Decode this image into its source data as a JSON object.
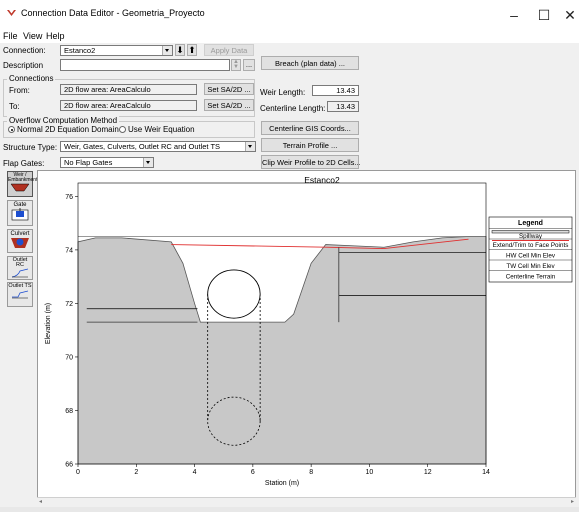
{
  "window": {
    "title": "Connection Data Editor - Geometria_Proyecto",
    "minimize": "–",
    "maximize": "☐",
    "close": "✕"
  },
  "menu": [
    "File",
    "View",
    "Help"
  ],
  "form": {
    "connection_label": "Connection:",
    "connection_value": "Estanco2",
    "apply_label": "Apply Data",
    "description_label": "Description",
    "description_value": "",
    "desc_btn": "...",
    "breach_btn": "Breach (plan data) ...",
    "connections_group": "Connections",
    "from_label": "From:",
    "from_value": "2D flow area: AreaCalculo",
    "to_label": "To:",
    "to_value": "2D flow area: AreaCalculo",
    "set_btn": "Set SA/2D ...",
    "weir_length_label": "Weir Length:",
    "weir_length_value": "13.43",
    "centerline_length_label": "Centerline Length:",
    "centerline_length_value": "13.43",
    "overflow_group": "Overflow Computation Method",
    "radio_normal": "Normal 2D Equation Domain",
    "radio_weir": "Use Weir Equation",
    "centerline_gis_btn": "Centerline GIS Coords...",
    "structure_type_label": "Structure Type:",
    "structure_type_value": "Weir, Gates, Culverts, Outlet RC and Outlet TS",
    "terrain_btn": "Terrain Profile ...",
    "flap_gates_label": "Flap Gates:",
    "flap_gates_value": "No Flap Gates",
    "clip_btn": "Clip Weir Profile to 2D Cells..."
  },
  "sidebar": [
    {
      "label": "Weir / Embankment",
      "icon": "weir-embankment-icon"
    },
    {
      "label": "Gate",
      "icon": "gate-icon"
    },
    {
      "label": "Culvert",
      "icon": "culvert-icon"
    },
    {
      "label": "Outlet RC",
      "icon": "outlet-rc-icon"
    },
    {
      "label": "Outlet TS",
      "icon": "outlet-ts-icon"
    }
  ],
  "chart_data": {
    "type": "line",
    "title": "Estanco2",
    "xlabel": "Station (m)",
    "ylabel": "Elevation (m)",
    "xlim": [
      0,
      14
    ],
    "ylim": [
      66,
      76.5
    ],
    "xticks": [
      0,
      2,
      4,
      6,
      8,
      10,
      12,
      14
    ],
    "yticks": [
      66,
      68,
      70,
      72,
      74,
      76
    ],
    "legend": {
      "title": "Legend",
      "placement": "right",
      "items": [
        {
          "label": "Spillway",
          "color": "#000000",
          "style": "double"
        },
        {
          "label": "Extend/Trim to Face Points",
          "color": "#e03030",
          "style": "solid"
        },
        {
          "label": "HW Cell Min Elev",
          "color": "#000000",
          "style": "none"
        },
        {
          "label": "TW Cell Min Elev",
          "color": "#000000",
          "style": "none"
        },
        {
          "label": "Centerline Terrain",
          "color": "#000000",
          "style": "none"
        }
      ]
    },
    "terrain": {
      "x": [
        0,
        0.6,
        1.5,
        3.2,
        3.6,
        4.0,
        4.2,
        4.35,
        7.1,
        7.4,
        8.0,
        8.5,
        9.5,
        10.5,
        11.5,
        12.5,
        13.4,
        14.0
      ],
      "y": [
        74.3,
        74.45,
        74.45,
        74.3,
        73.5,
        72.0,
        71.3,
        71.3,
        71.3,
        71.6,
        73.5,
        74.2,
        74.15,
        74.1,
        74.3,
        74.45,
        74.5,
        74.5
      ]
    },
    "extend_trim": {
      "x": [
        3.2,
        8.5,
        10.5,
        13.4
      ],
      "y": [
        74.2,
        74.1,
        74.05,
        74.4
      ]
    },
    "weir_top": {
      "x": [
        0,
        14
      ],
      "y": [
        74.5,
        74.5
      ]
    },
    "hw_cell_min_elev": {
      "x": [
        0.3,
        4.1
      ],
      "y": [
        71.8,
        71.8
      ]
    },
    "tw_cell_min_elev": {
      "x": [
        8.95,
        14.0
      ],
      "y": [
        72.3,
        72.3
      ]
    },
    "culvert": {
      "center_x": 5.35,
      "top_diameter": 1.8,
      "inlet_center_y": 72.35,
      "outlet_center_y": 67.6,
      "outlet_diameter": 1.8
    },
    "interior_lines": [
      {
        "x": [
          0.3,
          4.1
        ],
        "y": [
          71.3,
          71.3
        ]
      },
      {
        "x": [
          8.95,
          14.0
        ],
        "y": [
          73.9,
          73.9
        ]
      },
      {
        "x": [
          8.95,
          8.95
        ],
        "y": [
          71.3,
          74.1
        ]
      }
    ]
  }
}
